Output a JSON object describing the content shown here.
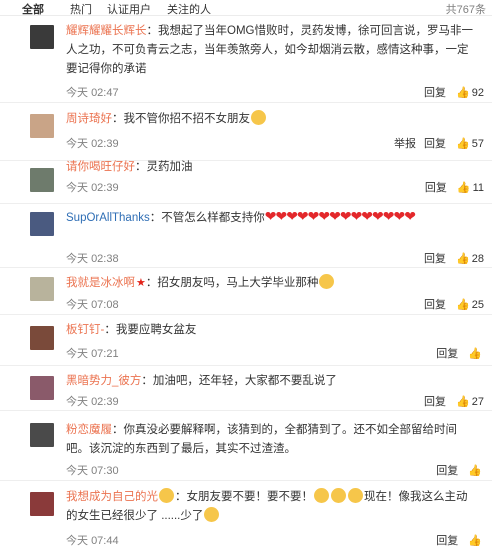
{
  "filters": {
    "all": "全部",
    "hot": "热门",
    "verified": "认证用户",
    "following": "关注的人",
    "total": "共767条"
  },
  "actions": {
    "reply": "回复",
    "report": "举报"
  },
  "comments": [
    {
      "username": "耀辉耀耀长辉长",
      "text": "：我想起了当年OMG惜败时，灵药发博，徐可回言说，罗马非一人之功，不可负青云之志，当年羡煞旁人，如今却烟消云散，感情这种事，一定要记得你的承诺",
      "date": "今天",
      "time": "02:47",
      "likes": "92",
      "avatar_color": "#3a3a3a"
    },
    {
      "username": "周诗琦好",
      "text": "：我不管你招不招不女朋友",
      "emoji": "grin",
      "date": "今天",
      "time": "02:39",
      "likes": "57",
      "avatar_color": "#c9a487"
    },
    {
      "username": "请你喝旺仔好",
      "text": "：灵药加油",
      "date": "今天",
      "time": "02:39",
      "likes": "11",
      "avatar_color": "#6e7b6c"
    },
    {
      "username": "SupOrAllThanks",
      "text": "：不管怎么样都支持你",
      "hearts": "❤❤❤❤❤❤❤❤❤❤❤❤❤❤",
      "date": "今天",
      "time": "02:38",
      "likes": "28",
      "avatar_color": "#4a5a80"
    },
    {
      "username": "我就是冰冰啊",
      "text": "：招女朋友吗，马上大学毕业那种",
      "emoji": "happy",
      "date": "今天",
      "time": "07:08",
      "likes": "25",
      "avatar_color": "#b8b39c"
    },
    {
      "username": "板钉钉-",
      "text": "：我要应聘女盆友",
      "date": "今天",
      "time": "07:21",
      "likes": "",
      "avatar_color": "#7a4a3a"
    },
    {
      "username": "黑暗势力_彼方",
      "text": "：加油吧，还年轻，大家都不要乱说了",
      "date": "今天",
      "time": "02:39",
      "likes": "27",
      "avatar_color": "#8a5a6a"
    },
    {
      "username": "粉恋魔履",
      "text": "：你真没必要解释啊，该猜到的，全都猜到了。还不如全部留给时间吧。该沉淀的东西到了最后，其实不过渣渣。",
      "date": "今天",
      "time": "07:30",
      "likes": "",
      "avatar_color": "#4a4a4a"
    },
    {
      "username": "我想成为自己的光",
      "text": "：女朋友要不要！要不要！",
      "text2": "现在！像我这么主动的女生已经很少了 ......少了",
      "date": "今天",
      "time": "07:44",
      "likes": "",
      "avatar_color": "#8a3a3a"
    }
  ]
}
